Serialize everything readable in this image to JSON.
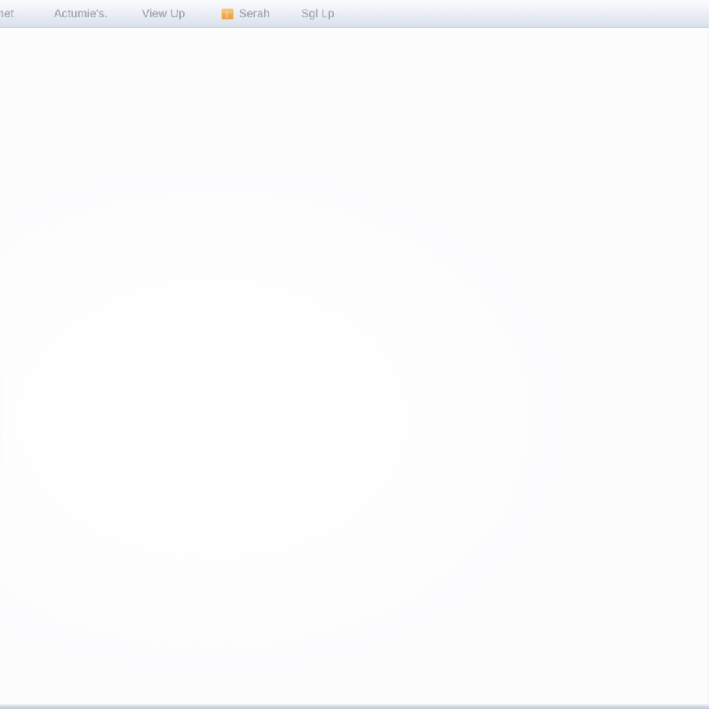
{
  "window": {
    "background_color": "#ffffff"
  },
  "toolbar": {
    "background_top_color": "#fbfcfe",
    "background_bottom_color": "#dde3ed",
    "border_color": "#ced5e2",
    "text_color": "#8b919d",
    "items": [
      {
        "label": "met",
        "icon": null,
        "truncated": true
      },
      {
        "label": "Actumie's.",
        "icon": null,
        "truncated": false
      },
      {
        "label": "View Up",
        "icon": null,
        "truncated": false
      },
      {
        "label": "Serah",
        "icon": "folder-icon",
        "truncated": true
      },
      {
        "label": "Sgl Lp",
        "icon": null,
        "truncated": false
      }
    ],
    "icon_color": "#f2ab4e"
  },
  "content": {
    "body_text": "",
    "background_color": "#fefefe"
  },
  "status_strip": {
    "color": "#c6cad9"
  }
}
